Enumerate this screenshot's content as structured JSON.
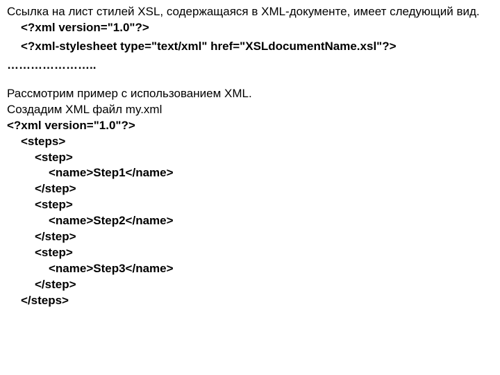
{
  "intro": {
    "line": "Ссылка на лист стилей XSL, содержащаяся в XML-документе, имеет следующий вид."
  },
  "link_example": {
    "decl": "<?xml version=\"1.0\"?>",
    "stylesheet": "<?xml-stylesheet type=\"text/xml\"  href=\"XSLdocumentName.xsl\"?>"
  },
  "dots": "…………………..",
  "example_intro": {
    "line1": "Рассмотрим пример с использованием XML.",
    "line2": "Создадим XML файл my.xml"
  },
  "xml_file": {
    "decl": "<?xml version=\"1.0\"?>",
    "open_steps": "<steps>",
    "s1_open": "<step>",
    "s1_name": "<name>Step1</name>",
    "s1_close": "</step>",
    "s2_open": "<step>",
    "s2_name": "<name>Step2</name>",
    "s2_close": "</step>",
    "s3_open": "<step>",
    "s3_name": "<name>Step3</name>",
    "s3_close": "</step>",
    "close_steps": "</steps>"
  }
}
